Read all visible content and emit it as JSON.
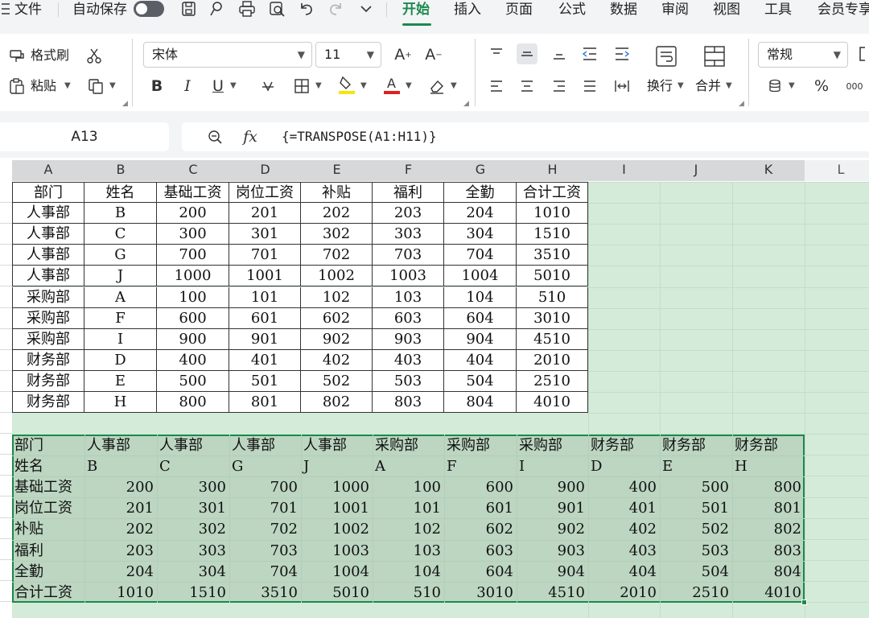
{
  "menubar": {
    "file": "文件",
    "autosave": "自动保存",
    "tabs": [
      "开始",
      "插入",
      "页面",
      "公式",
      "数据",
      "审阅",
      "视图",
      "工具",
      "会员专享"
    ],
    "active_tab": "开始"
  },
  "ribbon": {
    "format_painter": "格式刷",
    "paste": "粘贴",
    "font_name": "宋体",
    "font_size": "11",
    "bold": "B",
    "italic": "I",
    "underline": "U",
    "wrap": "换行",
    "merge": "合并",
    "number_format": "常规",
    "percent": "%",
    "thousands": "000"
  },
  "formula_bar": {
    "name_box": "A13",
    "fx": "fx",
    "formula": "{=TRANSPOSE(A1:H11)}"
  },
  "columns": [
    "A",
    "B",
    "C",
    "D",
    "E",
    "F",
    "G",
    "H",
    "I",
    "J",
    "K",
    "L"
  ],
  "table1": {
    "headers": [
      "部门",
      "姓名",
      "基础工资",
      "岗位工资",
      "补贴",
      "福利",
      "全勤",
      "合计工资"
    ],
    "rows": [
      [
        "人事部",
        "B",
        "200",
        "201",
        "202",
        "203",
        "204",
        "1010"
      ],
      [
        "人事部",
        "C",
        "300",
        "301",
        "302",
        "303",
        "304",
        "1510"
      ],
      [
        "人事部",
        "G",
        "700",
        "701",
        "702",
        "703",
        "704",
        "3510"
      ],
      [
        "人事部",
        "J",
        "1000",
        "1001",
        "1002",
        "1003",
        "1004",
        "5010"
      ],
      [
        "采购部",
        "A",
        "100",
        "101",
        "102",
        "103",
        "104",
        "510"
      ],
      [
        "采购部",
        "F",
        "600",
        "601",
        "602",
        "603",
        "604",
        "3010"
      ],
      [
        "采购部",
        "I",
        "900",
        "901",
        "902",
        "903",
        "904",
        "4510"
      ],
      [
        "财务部",
        "D",
        "400",
        "401",
        "402",
        "403",
        "404",
        "2010"
      ],
      [
        "财务部",
        "E",
        "500",
        "501",
        "502",
        "503",
        "504",
        "2510"
      ],
      [
        "财务部",
        "H",
        "800",
        "801",
        "802",
        "803",
        "804",
        "4010"
      ]
    ]
  },
  "table2": {
    "rows": [
      [
        "部门",
        "人事部",
        "人事部",
        "人事部",
        "人事部",
        "采购部",
        "采购部",
        "采购部",
        "财务部",
        "财务部",
        "财务部"
      ],
      [
        "姓名",
        "B",
        "C",
        "G",
        "J",
        "A",
        "F",
        "I",
        "D",
        "E",
        "H"
      ],
      [
        "基础工资",
        "200",
        "300",
        "700",
        "1000",
        "100",
        "600",
        "900",
        "400",
        "500",
        "800"
      ],
      [
        "岗位工资",
        "201",
        "301",
        "701",
        "1001",
        "101",
        "601",
        "901",
        "401",
        "501",
        "801"
      ],
      [
        "补贴",
        "202",
        "302",
        "702",
        "1002",
        "102",
        "602",
        "902",
        "402",
        "502",
        "802"
      ],
      [
        "福利",
        "203",
        "303",
        "703",
        "1003",
        "103",
        "603",
        "903",
        "403",
        "503",
        "803"
      ],
      [
        "全勤",
        "204",
        "304",
        "704",
        "1004",
        "104",
        "604",
        "904",
        "404",
        "504",
        "804"
      ],
      [
        "合计工资",
        "1010",
        "1510",
        "3510",
        "5010",
        "510",
        "3010",
        "4510",
        "2010",
        "2510",
        "4010"
      ]
    ]
  },
  "colors": {
    "accent": "#1a8a4c",
    "selection_fill": "#d3ebd8",
    "table_fill": "#bcd6c1",
    "highlight_bar": "#f5e50f",
    "font_color_bar": "#e02020"
  }
}
